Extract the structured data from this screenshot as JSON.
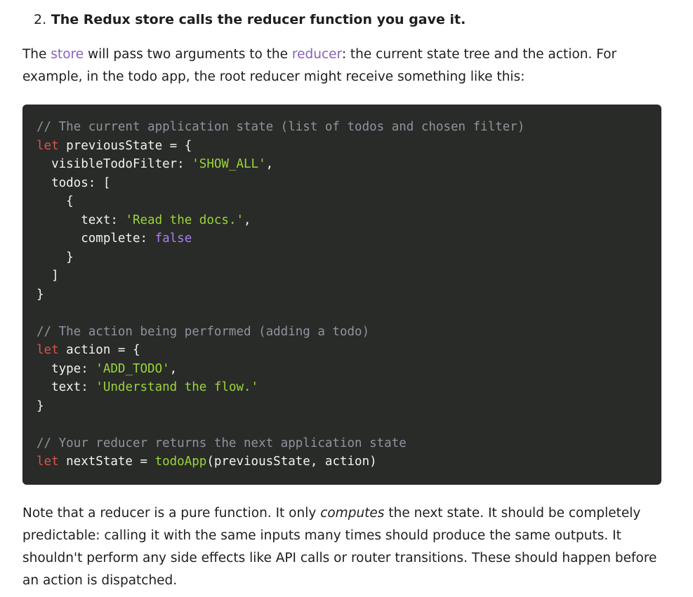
{
  "step": {
    "number": "2.",
    "title": "The Redux store calls the reducer function you gave it."
  },
  "intro": {
    "t1": "The ",
    "link_store": "store",
    "t2": " will pass two arguments to the ",
    "link_reducer": "reducer",
    "t3": ": the current state tree and the action. For example, in the todo app, the root reducer might receive something like this:"
  },
  "code": {
    "comment1": "// The current application state (list of todos and chosen filter)",
    "kw_let": "let",
    "var_previous": " previousState = {",
    "filter_key": "  visibleTodoFilter: ",
    "filter_val": "'SHOW_ALL'",
    "comma": ",",
    "todos_key": "  todos: [",
    "open_brace": "    {",
    "text_key": "      text: ",
    "text_val": "'Read the docs.'",
    "complete_key": "      complete: ",
    "complete_val": "false",
    "close_brace_inner": "    }",
    "close_bracket": "  ]",
    "close_brace": "}",
    "comment2": "// The action being performed (adding a todo)",
    "var_action": " action = {",
    "type_key": "  type: ",
    "type_val": "'ADD_TODO'",
    "text2_key": "  text: ",
    "text2_val": "'Understand the flow.'",
    "comment3": "// Your reducer returns the next application state",
    "var_next": " nextState = ",
    "fn_name": "todoApp",
    "fn_args": "(previousState, action)"
  },
  "note": {
    "t1": "Note that a reducer is a pure function. It only ",
    "em": "computes",
    "t2": " the next state. It should be completely predictable: calling it with the same inputs many times should produce the same outputs. It shouldn't perform any side effects like API calls or router transitions. These should happen before an action is dispatched."
  }
}
